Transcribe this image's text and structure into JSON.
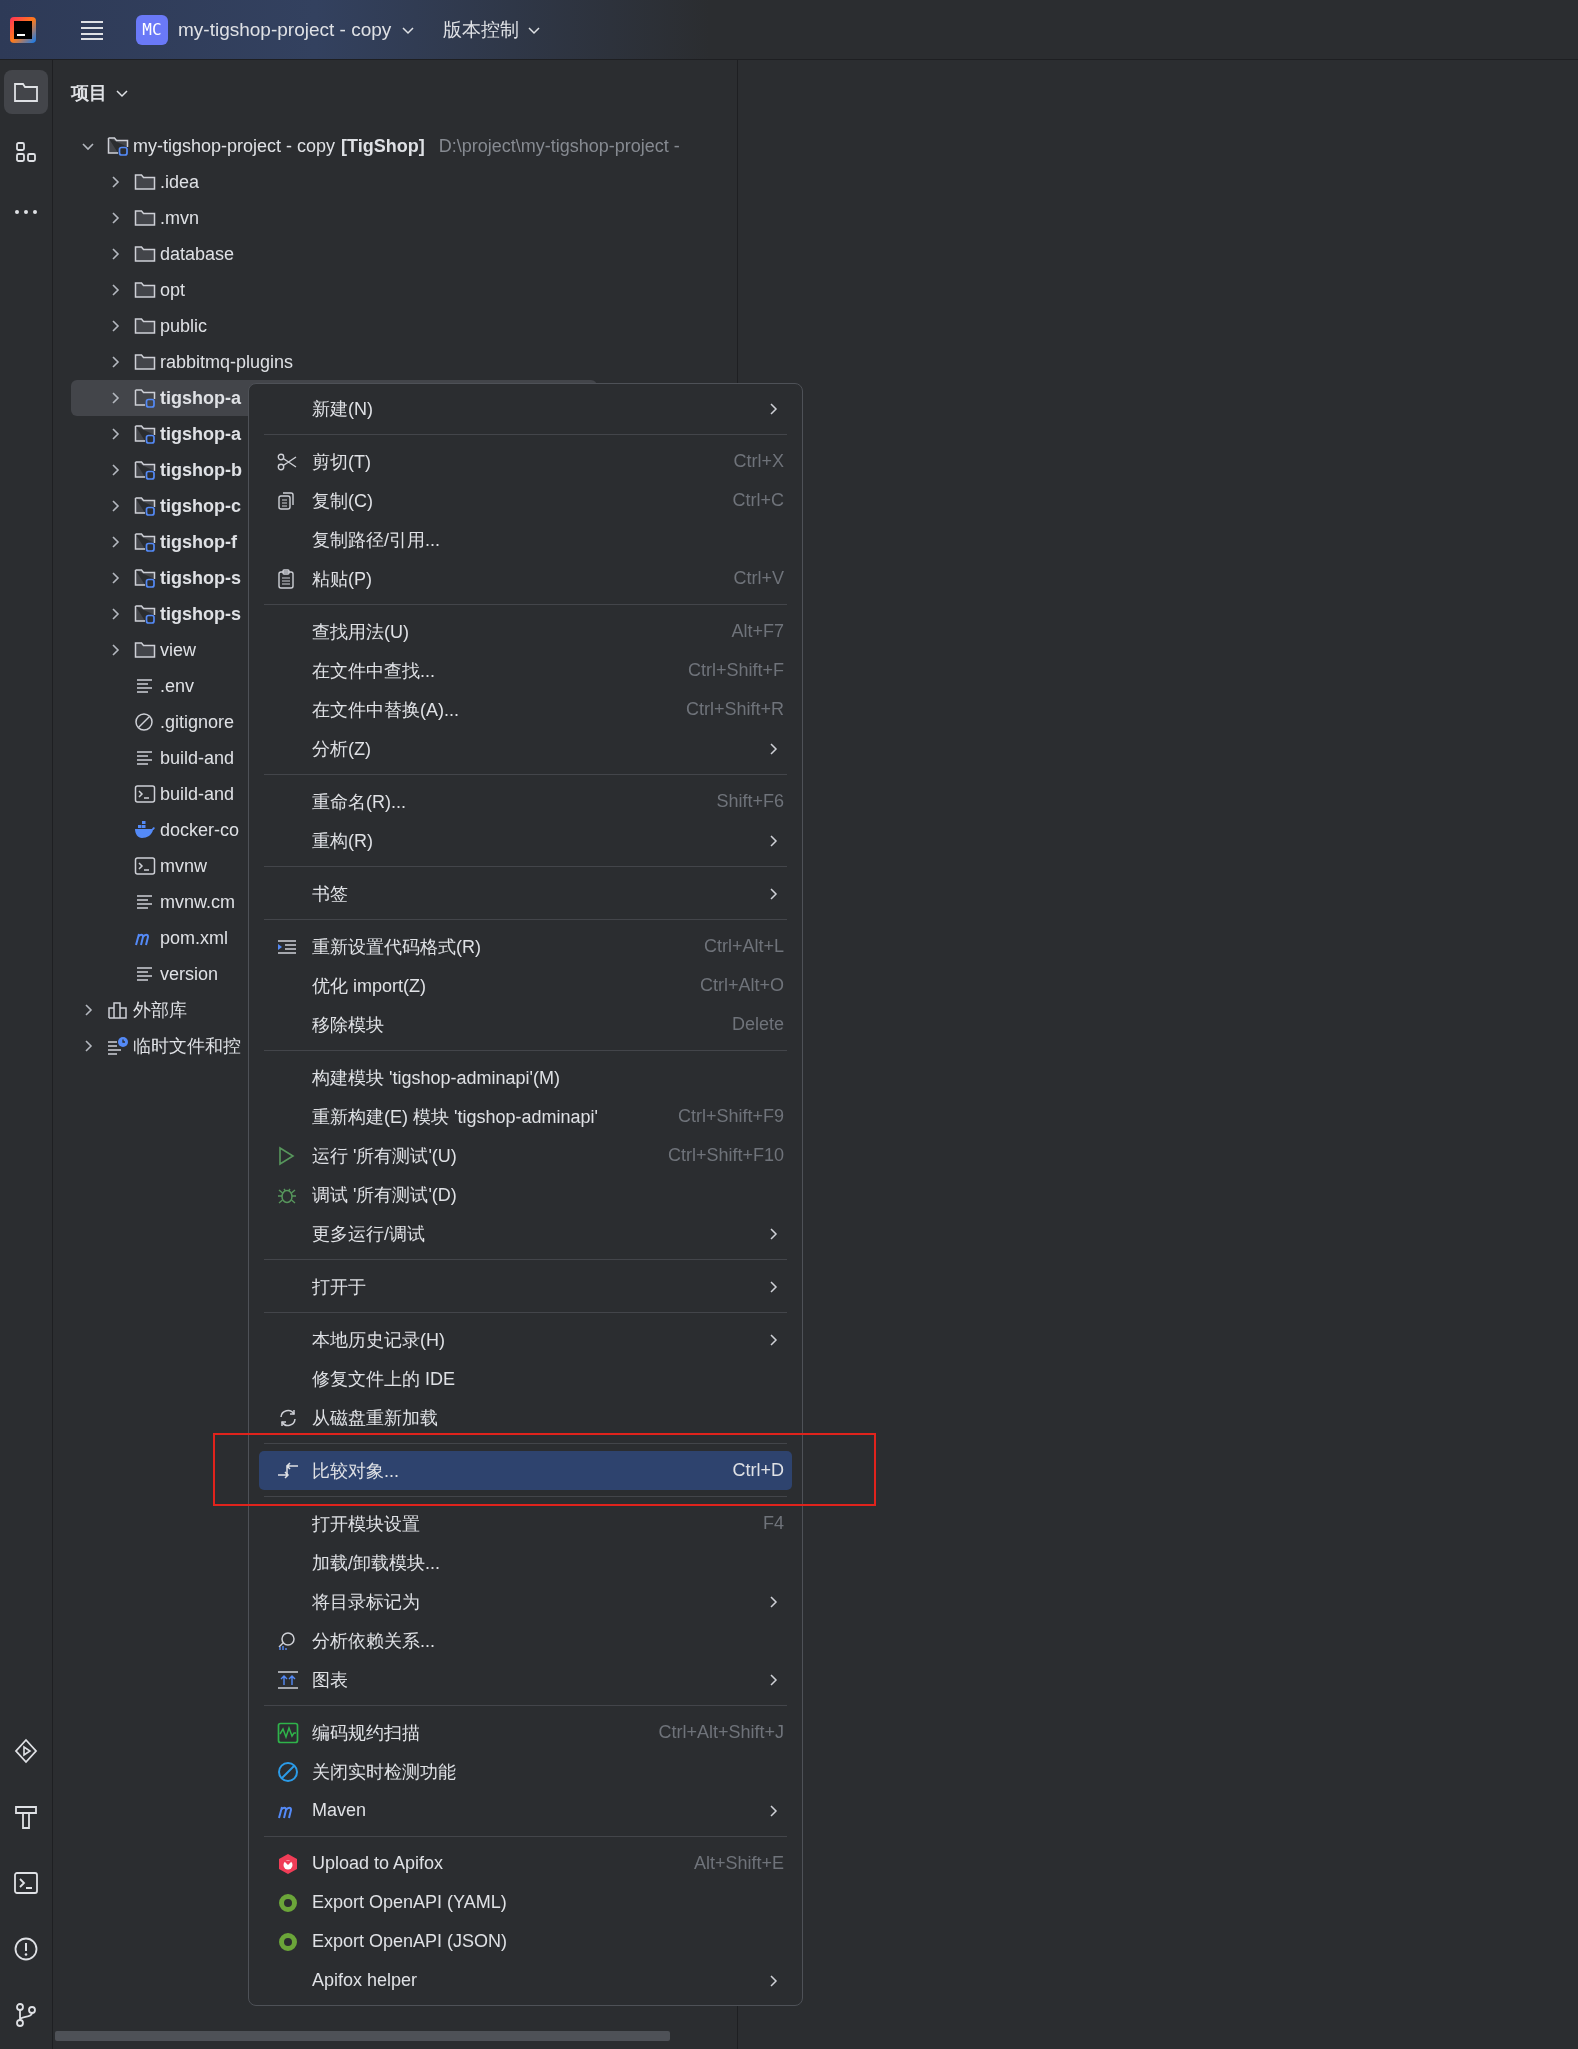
{
  "title_bar": {
    "project_badge": "MC",
    "project_name": "my-tigshop-project - copy",
    "vcs_menu": "版本控制"
  },
  "tool_strip": {
    "top": [
      {
        "kind": "folder",
        "selected": true
      },
      {
        "kind": "structure",
        "selected": false
      },
      {
        "kind": "more",
        "selected": false
      }
    ],
    "bottom": [
      {
        "kind": "services",
        "selected": false
      },
      {
        "kind": "build",
        "selected": false
      },
      {
        "kind": "terminal",
        "selected": false
      },
      {
        "kind": "problems",
        "selected": false
      },
      {
        "kind": "git",
        "selected": false
      }
    ]
  },
  "project_panel": {
    "title": "项目",
    "tree": [
      {
        "label": "my-tigshop-project - copy",
        "tag": "[TigShop]",
        "path": "D:\\project\\my-tigshop-project -",
        "kind": "module",
        "expanded": true,
        "selected": false,
        "children": [
          {
            "label": ".idea",
            "kind": "folder",
            "expanded": false,
            "selected": false
          },
          {
            "label": ".mvn",
            "kind": "folder",
            "expanded": false,
            "selected": false
          },
          {
            "label": "database",
            "kind": "folder",
            "expanded": false,
            "selected": false
          },
          {
            "label": "opt",
            "kind": "folder",
            "expanded": false,
            "selected": false
          },
          {
            "label": "public",
            "kind": "folder",
            "expanded": false,
            "selected": false
          },
          {
            "label": "rabbitmq-plugins",
            "kind": "folder",
            "expanded": false,
            "selected": false
          },
          {
            "label": "tigshop-a",
            "kind": "module",
            "expanded": false,
            "selected": true
          },
          {
            "label": "tigshop-a",
            "kind": "module",
            "expanded": false,
            "selected": false
          },
          {
            "label": "tigshop-b",
            "kind": "module",
            "expanded": false,
            "selected": false
          },
          {
            "label": "tigshop-c",
            "kind": "module",
            "expanded": false,
            "selected": false
          },
          {
            "label": "tigshop-f",
            "kind": "module",
            "expanded": false,
            "selected": false
          },
          {
            "label": "tigshop-s",
            "kind": "module",
            "expanded": false,
            "selected": false
          },
          {
            "label": "tigshop-s",
            "kind": "module",
            "expanded": false,
            "selected": false
          },
          {
            "label": "view",
            "kind": "folder",
            "expanded": false,
            "selected": false
          },
          {
            "label": ".env",
            "kind": "text",
            "selected": false
          },
          {
            "label": ".gitignore",
            "kind": "ignore",
            "selected": false
          },
          {
            "label": "build-and",
            "kind": "text",
            "selected": false
          },
          {
            "label": "build-and",
            "kind": "shell",
            "selected": false
          },
          {
            "label": "docker-co",
            "kind": "docker",
            "selected": false
          },
          {
            "label": "mvnw",
            "kind": "shell",
            "selected": false
          },
          {
            "label": "mvnw.cm",
            "kind": "text",
            "selected": false
          },
          {
            "label": "pom.xml",
            "kind": "maven",
            "selected": false
          },
          {
            "label": "version",
            "kind": "text",
            "selected": false
          }
        ]
      },
      {
        "label": "外部库",
        "kind": "library",
        "expanded": false,
        "selected": false
      },
      {
        "label": "临时文件和控",
        "kind": "scratch",
        "expanded": false,
        "selected": false
      }
    ]
  },
  "context_menu": {
    "groups": [
      [
        {
          "label": "新建(N)",
          "submenu": true,
          "kind": "plain",
          "selected": false
        }
      ],
      [
        {
          "label": "剪切(T)",
          "shortcut": "Ctrl+X",
          "kind": "cut",
          "selected": false
        },
        {
          "label": "复制(C)",
          "shortcut": "Ctrl+C",
          "kind": "copy",
          "selected": false
        },
        {
          "label": "复制路径/引用...",
          "kind": "plain",
          "selected": false
        },
        {
          "label": "粘贴(P)",
          "shortcut": "Ctrl+V",
          "kind": "paste",
          "selected": false
        }
      ],
      [
        {
          "label": "查找用法(U)",
          "shortcut": "Alt+F7",
          "kind": "plain",
          "selected": false
        },
        {
          "label": "在文件中查找...",
          "shortcut": "Ctrl+Shift+F",
          "kind": "plain",
          "selected": false
        },
        {
          "label": "在文件中替换(A)...",
          "shortcut": "Ctrl+Shift+R",
          "kind": "plain",
          "selected": false
        },
        {
          "label": "分析(Z)",
          "submenu": true,
          "kind": "plain",
          "selected": false
        }
      ],
      [
        {
          "label": "重命名(R)...",
          "shortcut": "Shift+F6",
          "kind": "plain",
          "selected": false
        },
        {
          "label": "重构(R)",
          "submenu": true,
          "kind": "plain",
          "selected": false
        }
      ],
      [
        {
          "label": "书签",
          "submenu": true,
          "kind": "plain",
          "selected": false
        }
      ],
      [
        {
          "label": "重新设置代码格式(R)",
          "shortcut": "Ctrl+Alt+L",
          "kind": "format",
          "selected": false
        },
        {
          "label": "优化 import(Z)",
          "shortcut": "Ctrl+Alt+O",
          "kind": "plain",
          "selected": false
        },
        {
          "label": "移除模块",
          "shortcut": "Delete",
          "kind": "plain",
          "selected": false
        }
      ],
      [
        {
          "label": "构建模块 'tigshop-adminapi'(M)",
          "kind": "plain",
          "selected": false
        },
        {
          "label": "重新构建(E) 模块 'tigshop-adminapi'",
          "shortcut": "Ctrl+Shift+F9",
          "kind": "plain",
          "selected": false
        },
        {
          "label": "运行 '所有测试'(U)",
          "shortcut": "Ctrl+Shift+F10",
          "kind": "run",
          "selected": false
        },
        {
          "label": "调试 '所有测试'(D)",
          "kind": "debug",
          "selected": false
        },
        {
          "label": "更多运行/调试",
          "submenu": true,
          "kind": "plain",
          "selected": false
        }
      ],
      [
        {
          "label": "打开于",
          "submenu": true,
          "kind": "plain",
          "selected": false
        }
      ],
      [
        {
          "label": "本地历史记录(H)",
          "submenu": true,
          "kind": "plain",
          "selected": false
        },
        {
          "label": "修复文件上的 IDE",
          "kind": "plain",
          "selected": false
        },
        {
          "label": "从磁盘重新加载",
          "kind": "reload",
          "selected": false
        }
      ],
      [
        {
          "label": "比较对象...",
          "shortcut": "Ctrl+D",
          "kind": "compare",
          "selected": true
        }
      ],
      [
        {
          "label": "打开模块设置",
          "shortcut": "F4",
          "kind": "plain",
          "selected": false
        },
        {
          "label": "加载/卸载模块...",
          "kind": "plain",
          "selected": false
        },
        {
          "label": "将目录标记为",
          "submenu": true,
          "kind": "plain",
          "selected": false
        },
        {
          "label": "分析依赖关系...",
          "kind": "dependencies",
          "selected": false
        },
        {
          "label": "图表",
          "submenu": true,
          "kind": "diagram",
          "selected": false
        }
      ],
      [
        {
          "label": "编码规约扫描",
          "shortcut": "Ctrl+Alt+Shift+J",
          "kind": "scan",
          "selected": false
        },
        {
          "label": "关闭实时检测功能",
          "kind": "disable",
          "selected": false
        },
        {
          "label": "Maven",
          "submenu": true,
          "kind": "maven",
          "selected": false
        }
      ],
      [
        {
          "label": "Upload to Apifox",
          "shortcut": "Alt+Shift+E",
          "kind": "apifox",
          "selected": false
        },
        {
          "label": "Export OpenAPI (YAML)",
          "kind": "openapi",
          "selected": false
        },
        {
          "label": "Export OpenAPI (JSON)",
          "kind": "openapi",
          "selected": false
        },
        {
          "label": "Apifox helper",
          "submenu": true,
          "kind": "plain",
          "selected": false
        }
      ]
    ]
  }
}
